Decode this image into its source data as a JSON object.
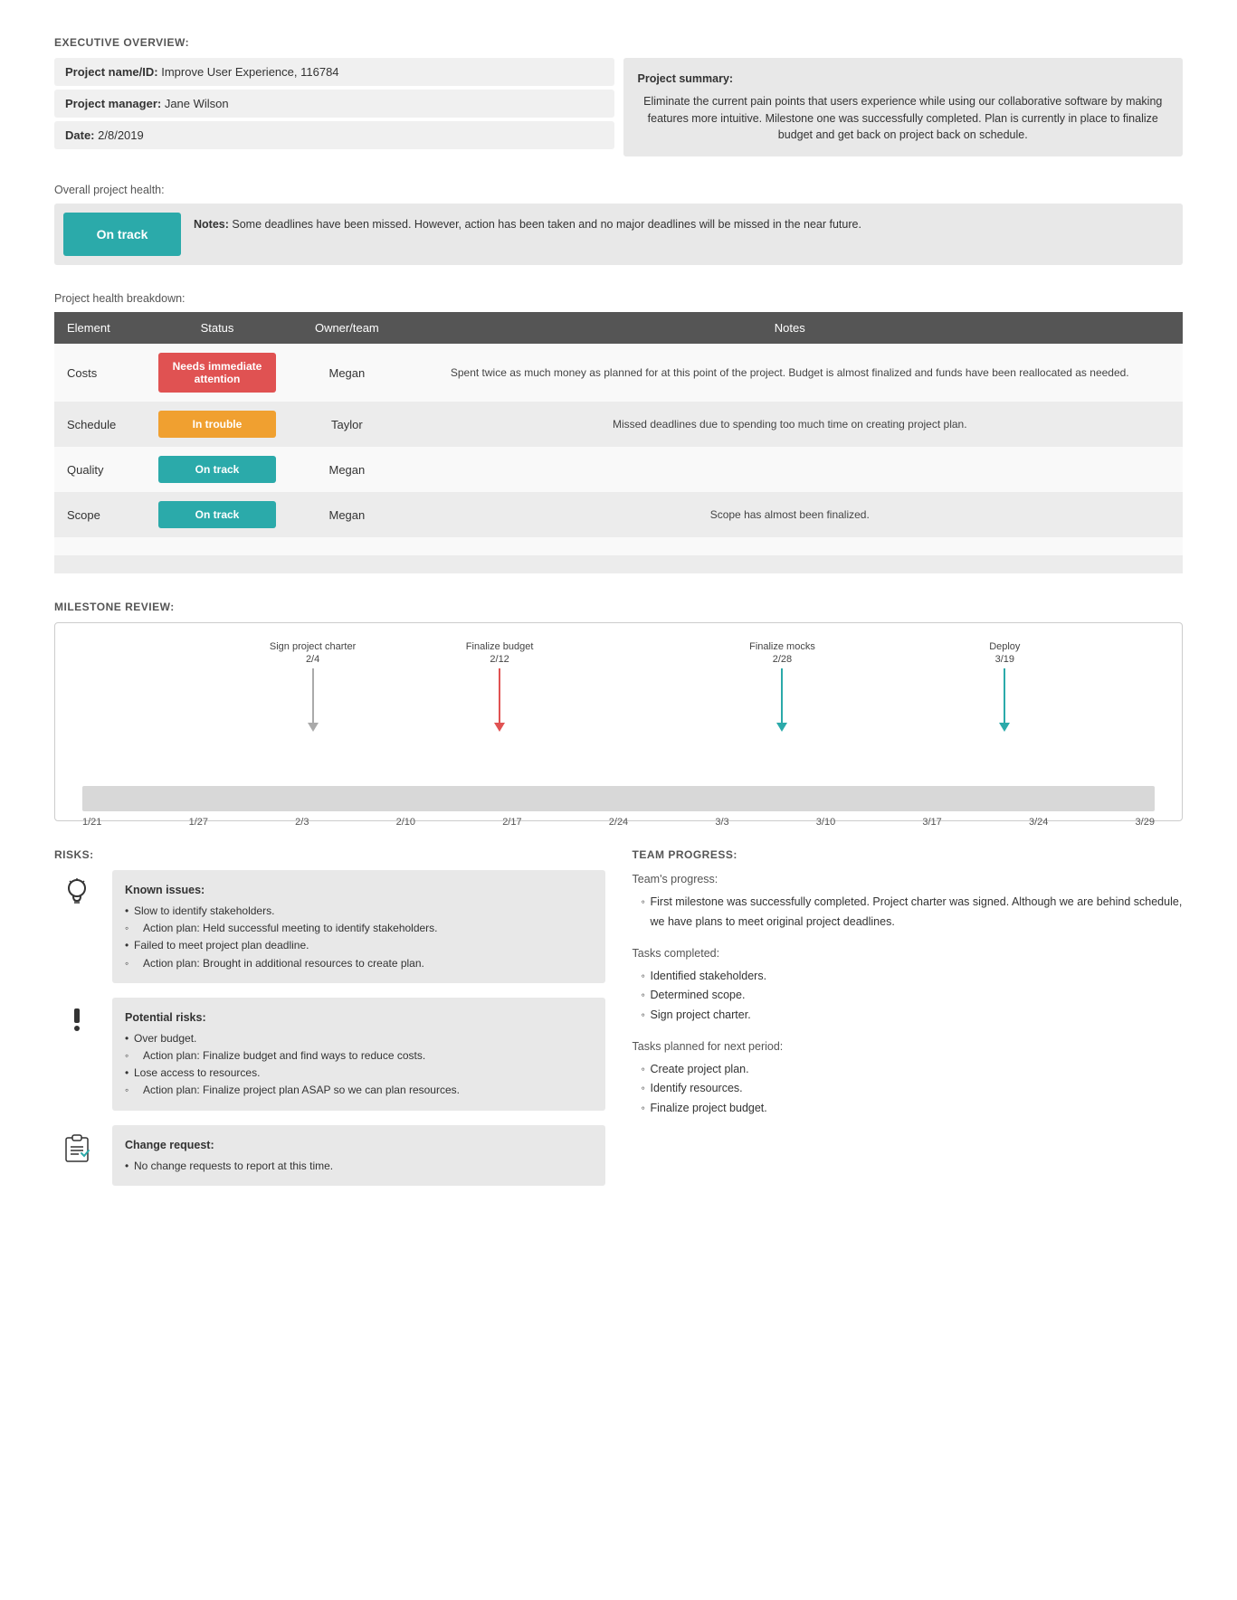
{
  "page": {
    "execOverview": {
      "sectionTitle": "EXECUTIVE OVERVIEW:",
      "fields": [
        {
          "label": "Project name/ID:",
          "value": "Improve User Experience, 116784"
        },
        {
          "label": "Project manager:",
          "value": "Jane Wilson"
        },
        {
          "label": "Date:",
          "value": "2/8/2019"
        }
      ],
      "summary": {
        "label": "Project summary:",
        "text": "Eliminate the current pain points that users experience while using our collaborative software by making features more intuitive. Milestone one was successfully completed. Plan is currently in place to finalize budget and get back on project back on schedule."
      }
    },
    "overallHealth": {
      "label": "Overall project health:",
      "status": "On track",
      "notesLabel": "Notes:",
      "notesText": "Some deadlines have been missed. However, action has been taken and no major deadlines will be missed in the near future."
    },
    "breakdown": {
      "label": "Project health breakdown:",
      "headers": [
        "Element",
        "Status",
        "Owner/team",
        "Notes"
      ],
      "rows": [
        {
          "element": "Costs",
          "status": "Needs immediate attention",
          "statusType": "red",
          "owner": "Megan",
          "notes": "Spent twice as much money as planned for at this point of the project. Budget is almost finalized and funds have been reallocated as needed."
        },
        {
          "element": "Schedule",
          "status": "In trouble",
          "statusType": "orange",
          "owner": "Taylor",
          "notes": "Missed deadlines due to spending too much time on creating project plan."
        },
        {
          "element": "Quality",
          "status": "On track",
          "statusType": "teal",
          "owner": "Megan",
          "notes": ""
        },
        {
          "element": "Scope",
          "status": "On track",
          "statusType": "teal",
          "owner": "Megan",
          "notes": "Scope has almost been finalized."
        },
        {
          "element": "",
          "status": "",
          "statusType": "",
          "owner": "",
          "notes": ""
        },
        {
          "element": "",
          "status": "",
          "statusType": "",
          "owner": "",
          "notes": ""
        }
      ]
    },
    "milestoneReview": {
      "sectionTitle": "MILESTONE REVIEW:",
      "milestones": [
        {
          "label": "Sign project charter",
          "date": "2/4",
          "type": "gray",
          "posPercent": 18
        },
        {
          "label": "Finalize budget",
          "date": "2/12",
          "type": "red",
          "posPercent": 36
        },
        {
          "label": "Finalize mocks",
          "date": "2/28",
          "type": "teal",
          "posPercent": 62
        },
        {
          "label": "Deploy",
          "date": "3/19",
          "type": "teal",
          "posPercent": 84
        }
      ],
      "axisLabels": [
        "1/21",
        "1/27",
        "2/3",
        "2/10",
        "2/17",
        "2/24",
        "3/3",
        "3/10",
        "3/17",
        "3/24",
        "3/29"
      ]
    },
    "risks": {
      "sectionTitle": "RISKS:",
      "items": [
        {
          "iconType": "bulb",
          "title": "Known issues:",
          "lines": [
            {
              "type": "bullet",
              "text": "Slow to identify stakeholders."
            },
            {
              "type": "sub",
              "text": "Action plan: Held successful meeting to identify stakeholders."
            },
            {
              "type": "bullet",
              "text": "Failed to meet project plan deadline."
            },
            {
              "type": "sub",
              "text": "Action plan: Brought in additional resources to create plan."
            }
          ]
        },
        {
          "iconType": "exclaim",
          "title": "Potential risks:",
          "lines": [
            {
              "type": "bullet",
              "text": "Over budget."
            },
            {
              "type": "sub",
              "text": "Action plan: Finalize budget and find ways to reduce costs."
            },
            {
              "type": "bullet",
              "text": "Lose access to resources."
            },
            {
              "type": "sub",
              "text": "Action plan: Finalize project plan ASAP so we can plan resources."
            }
          ]
        },
        {
          "iconType": "clipboard",
          "title": "Change request:",
          "lines": [
            {
              "type": "bullet",
              "text": "No change requests to report at this time."
            }
          ]
        }
      ]
    },
    "teamProgress": {
      "sectionTitle": "TEAM PROGRESS:",
      "introLabel": "Team's progress:",
      "introText": "First milestone was successfully completed. Project charter was signed. Although we are behind schedule, we have plans to meet original project deadlines.",
      "completed": {
        "label": "Tasks completed:",
        "items": [
          "Identified stakeholders.",
          "Determined scope.",
          "Sign project charter."
        ]
      },
      "planned": {
        "label": "Tasks planned for next period:",
        "items": [
          "Create project plan.",
          "Identify resources.",
          "Finalize project budget."
        ]
      }
    }
  }
}
